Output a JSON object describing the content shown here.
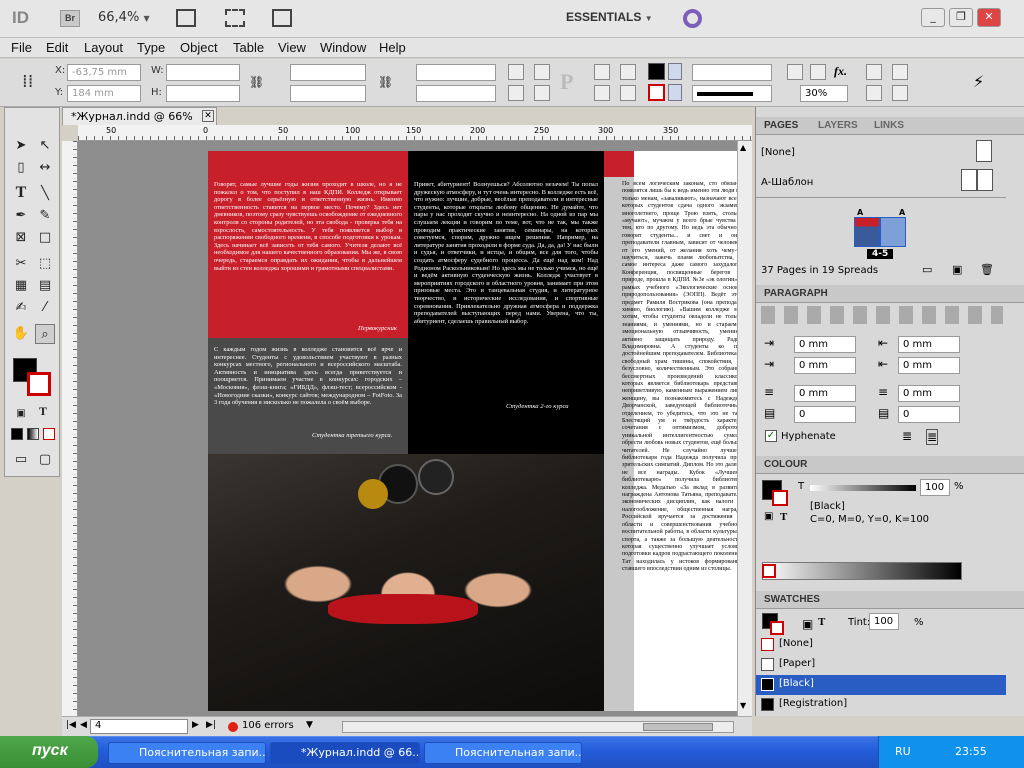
{
  "appbar": {
    "logo": "ID",
    "bridge": "Br",
    "zoom": "66,4%",
    "workspace": "ESSENTIALS"
  },
  "menu": [
    "File",
    "Edit",
    "Layout",
    "Type",
    "Object",
    "Table",
    "View",
    "Window",
    "Help"
  ],
  "control": {
    "x_label": "X:",
    "x_value": "-63,75 mm",
    "y_label": "Y:",
    "y_value": "184 mm",
    "w_label": "W:",
    "h_label": "H:",
    "stroke_weight": "",
    "percent": "30%"
  },
  "document": {
    "tab_title": "*Журнал.indd @ 66%",
    "ruler_marks": [
      "50",
      "0",
      "50",
      "100",
      "150",
      "200",
      "250",
      "300",
      "350"
    ]
  },
  "spread": {
    "col1_text": "Говорят, самые лучшие годы жизни проходят в школе, но я не пожалел о том, что поступил в наш КДПИ. Колледж открывает дорогу в более серьёзную и ответственную жизнь. Именно ответственность ставится на первое место. Почему? Здесь нет дневников, поэтому сразу чувствуешь освобождение от ежедневного контроля со стороны родителей, но эта свобода - проверка тебя на взрослость, самостоятельность. У тебя появляется выбор в распоряжении свободного времени, в способе подготовки к урокам. Здесь начинает всё зависеть от тебя самого. Учителя делают всё необходимое для нашего качественного образования. Мы же, в свою очередь, стараемся оправдать их ожидания, чтобы в дальнейшем выйти из стен колледжа хорошими и грамотными специалистами.",
    "col1_sig": "Первокурсник",
    "col2_text": "С каждым годом жизнь в колледже становится всё ярче и интереснее. Студенты с удовольствием участвуют в разных конкурсах местного, регионального и всероссийского масштаба. Активность и инициатива здесь всегда приветствуется и поощряется. Принимаем участие в конкурсах: городских – «Московия», флэш-книга; «ГИБДД», флэш-тест; всероссийском - «Новогодние сказки», конкурс сайтов; международном – FotFoto. За 3 года обучения я нисколько не пожалела о своём выборе.",
    "col2_sig": "Студентка третьего курса.",
    "col3_text": "Привет, абитуриент! Волнуешься? Абсолютно незачем! Ты попал дружескую атмосферу, и тут очень интересно. В колледже есть всё, что нужно: лучшие, добрые, весёлые преподаватели и интересные студенты, которые открыты любому общению. Не думайте, что пары у нас проходят скучно и неинтересно. На одной из пар мы слушаем лекции и говорим по теме, вот, что не так, мы также проводим практические занятия, семинары, на которых советуемся, спорим, дружно ищем решения. Например, на литературе занятия проходили в форме суда. Да, да, да! У нас были и судья, и ответчики, и истцы, и общим, все для того, чтобы создать атмосферу судебного процесса. Да ещё над ком! Над Родионом Раскольниковым! Но здесь мы не только учимся, но ещё и ведём активную студенческую жизнь. Колледж участвует в мероприятиях городского и областного уровня, занимает при этом призовые места. Это и танцевальная студия, и литературное творчество, и исторические исследования, и спортивные соревнования. Привлекательно дружная атмосфера и поддержка преподавателей выступающих перед нами. Уверена, что ты, абитуриент, сделаешь правильный выбор.",
    "col3_sig": "Студентка 2-го курса",
    "col4_text": "По всем логическим законам, сто обязаны появлятся лишь бы к ведь именно эти люди не только менам, «заваливают», назначают всем, которых студентов сдача одного экзамена многолетнего, проще Трою взять, столько «мучают», мучаюм у всего брые чувства к тем, кто по другому. Но ведь эта обычного говорят студенты... и свет и они, преподаватели главным, зависит от человека, от его умений, от желания хоть чему-то научиться, зажечь пламя любопытства, а самое интереса даже самого захудалого. Конференция, посвященные берегов к природе, прошла в КДПИ. №3е «эк ологии» в рамках учебного «Экологические основы природопользования» (ЭОПП). Ведёт этот предмет Рамиля Вострикова (она преподает химию, биологию). «Вашим колледже мы хотим, чтобы студенты овладели не только знаниями, и умениями, но и стараемся эмоциональную отзывчивость, умениям активно защищать природу. Радиа Владимировна. А студенты ко по-достойнейшим преподавателем. Библиотека – свободный храм тишины, спокойствия, и, безусловно, количественным. Это собрание бессмертных произведений классиков, которых является библиотекарь представит неприветливую, каменным выражением лица женщину, вы познакомитесь с Надеждой Дворчанской, заведующей библиотечным отделением, то убедитесь, что это не так. Блестящий ум и твёрдость характера сочетания с оптимизмом, добротой, уникальной интеллигентностью сумели обрести любовь новых студентов, ещё больше читателей. Не случайно лучшего библиотекаря года Надежда получила приз зрительских симпатий. Диплом. Но это далеко не все награды. Кубок «Лучшему библиотекарю» получила библиотеку колледжа. Медалью «За вклад в развитие награждена Антонова Татьяна, преподаватель экономических дисциплин, как налоги и налогообложение, общественная награда Российской вручается за достижения в области и совершенствования учебной, воспитательной работы, в области культуры и спорта, а также за большую деятельность, которая существенно улучшает условия подготовки кадров подрастающего поколения. Тат находилась у истоков формирования ставшего впоследствии одним из столицы."
  },
  "status": {
    "page": "4",
    "errors": "106 errors"
  },
  "panels": {
    "pages": {
      "tabs": [
        "PAGES",
        "LAYERS",
        "LINKS"
      ],
      "none": "[None]",
      "master": "A-Шаблон",
      "spread_label_left": "A",
      "spread_label_right": "A",
      "spread_num": "4-5",
      "count": "37 Pages in 19 Spreads"
    },
    "paragraph": {
      "title": "PARAGRAPH",
      "left_indent": "0 mm",
      "right_indent": "0 mm",
      "first_indent": "0 mm",
      "last_indent": "0 mm",
      "space_before": "0 mm",
      "space_after": "0 mm",
      "drop_lines": "0",
      "drop_chars": "0",
      "hyphenate": "Hyphenate"
    },
    "colour": {
      "title": "COLOUR",
      "t_label": "T",
      "value": "100",
      "pct": "%",
      "name": "[Black]",
      "cmyk": "C=0, M=0, Y=0, K=100"
    },
    "swatches": {
      "title": "SWATCHES",
      "tint_label": "Tint:",
      "tint_value": "100",
      "pct": "%",
      "items": [
        "[None]",
        "[Paper]",
        "[Black]",
        "[Registration]"
      ]
    }
  },
  "taskbar": {
    "start": "пуск",
    "items": [
      "Пояснительная запи...",
      "*Журнал.indd @ 66...",
      "Пояснительная запи..."
    ],
    "lang": "RU",
    "time": "23:55"
  },
  "colors": {
    "accent_red": "#c8202a",
    "dark_gray": "#4a4a4a",
    "black": "#000000",
    "panel_bg": "#d8d8d8",
    "selection_blue": "#2a5dc4"
  }
}
